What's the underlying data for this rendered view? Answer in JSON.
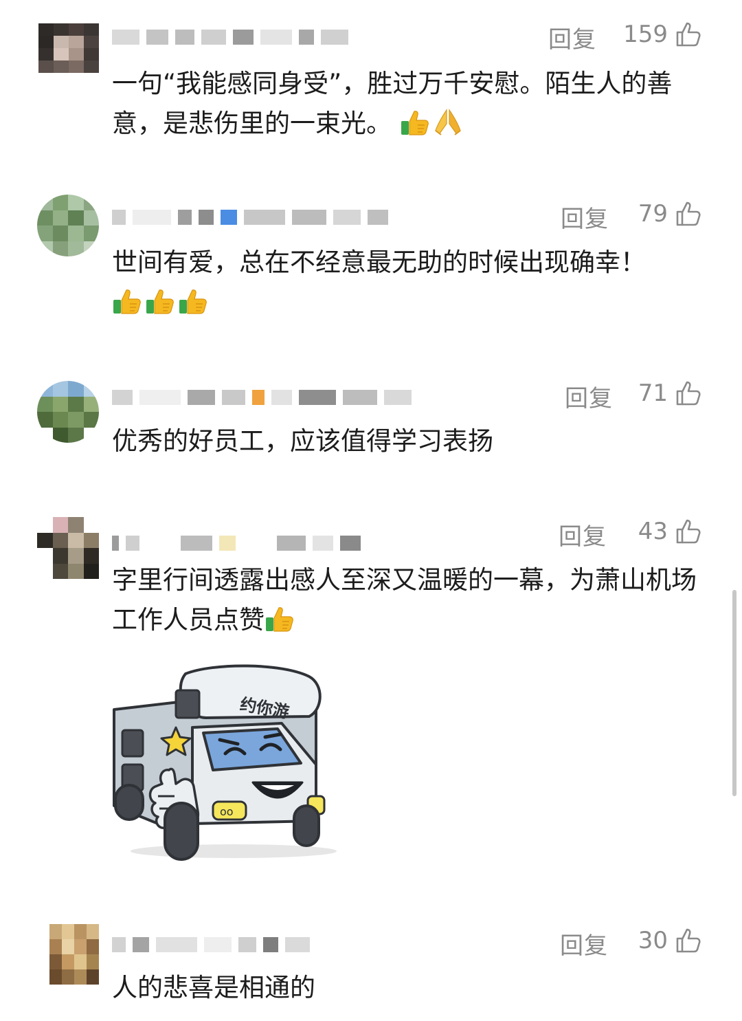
{
  "comments": [
    {
      "reply_label": "回复",
      "like_count": "159",
      "text": "一句“我能感同身受”，胜过万千安慰。陌生人的善意，是悲伤里的一束光。",
      "emojis": [
        "thumbs-up-emoji",
        "praying-hands-emoji"
      ]
    },
    {
      "reply_label": "回复",
      "like_count": "79",
      "text": "世间有爱，总在不经意最无助的时候出现确幸！",
      "emojis": [
        "thumbs-up-emoji",
        "thumbs-up-emoji",
        "thumbs-up-emoji"
      ]
    },
    {
      "reply_label": "回复",
      "like_count": "71",
      "text": "优秀的好员工，应该值得学习表扬",
      "emojis": []
    },
    {
      "reply_label": "回复",
      "like_count": "43",
      "text": "字里行间透露出感人至深又温暖的一幕，为萧山机场工作人员点赞",
      "emojis": [
        "thumbs-up-emoji"
      ],
      "sticker": {
        "icon": "camper-van-thumbs-up-sticker",
        "sign_text": "约你游"
      }
    },
    {
      "reply_label": "回复",
      "like_count": "30",
      "text": "人的悲喜是相通的",
      "emojis": []
    }
  ],
  "colors": {
    "meta_gray": "#8a8a8a",
    "text": "#1c1c1c",
    "scrollbar": "#c7c7c7"
  }
}
